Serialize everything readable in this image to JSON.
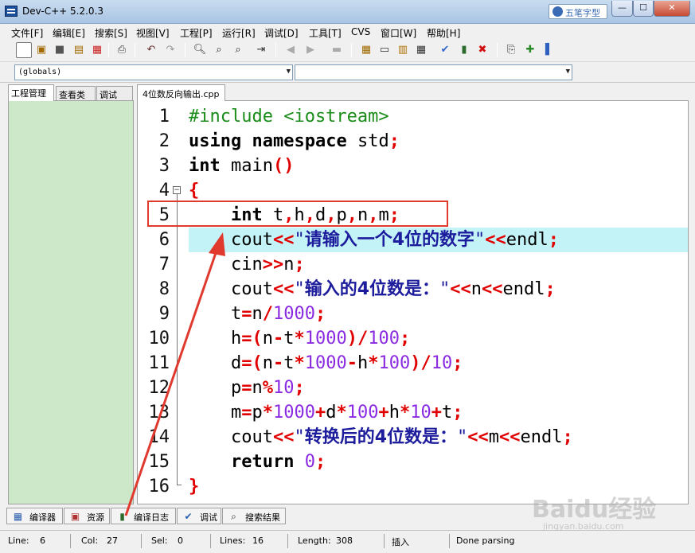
{
  "window": {
    "title": "Dev-C++ 5.2.0.3",
    "ime_label": "五笔字型",
    "min": "0",
    "max": "1",
    "close": "r"
  },
  "menu": [
    "文件[F]",
    "编辑[E]",
    "搜索[S]",
    "视图[V]",
    "工程[P]",
    "运行[R]",
    "调试[D]",
    "工具[T]",
    "CVS",
    "窗口[W]",
    "帮助[H]"
  ],
  "toolbar_icons": [
    "new-file-icon",
    "open-icon",
    "save-icon",
    "save-all-icon",
    "close-file-icon",
    "print-icon",
    "undo-icon",
    "redo-icon",
    "find-icon",
    "replace-icon",
    "find-next-icon",
    "goto-line-icon",
    "back-icon",
    "forward-icon",
    "bookmark-icon",
    "compile-icon",
    "run-icon",
    "compile-run-icon",
    "rebuild-icon",
    "check-icon",
    "chart-icon",
    "stop-icon",
    "insert-icon",
    "add-icon",
    "help-icon"
  ],
  "combos": {
    "scope": "(globals)",
    "member": ""
  },
  "left_tabs": [
    "工程管理",
    "查看类",
    "调试"
  ],
  "editor": {
    "file_tab": "4位数反向输出.cpp",
    "line_numbers": [
      "1",
      "2",
      "3",
      "4",
      "5",
      "6",
      "7",
      "8",
      "9",
      "10",
      "11",
      "12",
      "13",
      "14",
      "15",
      "16"
    ],
    "line_code": [
      "#include <iostream>",
      "using namespace std;",
      "int main()",
      "{",
      "    int t,h,d,p,n,m;",
      "    cout<<\"请输入一个4位的数字\"<<endl;",
      "    cin>>n;",
      "    cout<<\"输入的4位数是：\"<<n<<endl;",
      "    t=n/1000;",
      "    h=(n-t*1000)/100;",
      "    d=(n-t*1000-h*100)/10;",
      "    p=n%10;",
      "    m=p*1000+d*100+h*10+t;",
      "    cout<<\"转换后的4位数是：\"<<m<<endl;",
      "    return 0;",
      "}"
    ],
    "highlight_line": 6
  },
  "bottom_tabs": [
    "编译器",
    "资源",
    "编译日志",
    "调试",
    "搜索结果"
  ],
  "status": {
    "line_label": "Line:",
    "line_val": "6",
    "col_label": "Col:",
    "col_val": "27",
    "sel_label": "Sel:",
    "sel_val": "0",
    "lines_label": "Lines:",
    "lines_val": "16",
    "length_label": "Length:",
    "length_val": "308",
    "mode": "插入",
    "message": "Done parsing"
  },
  "watermark": {
    "brand": "Baidu经验",
    "url": "jingyan.baidu.com"
  },
  "colors": {
    "highlight": "#c4f3f7",
    "annotation": "#e03a2f",
    "keyword": "#000000",
    "preprocessor": "#198c19",
    "operator": "#e00000",
    "number": "#8a2be2",
    "string": "#1c1c9c",
    "left_panel": "#cde7c9"
  }
}
